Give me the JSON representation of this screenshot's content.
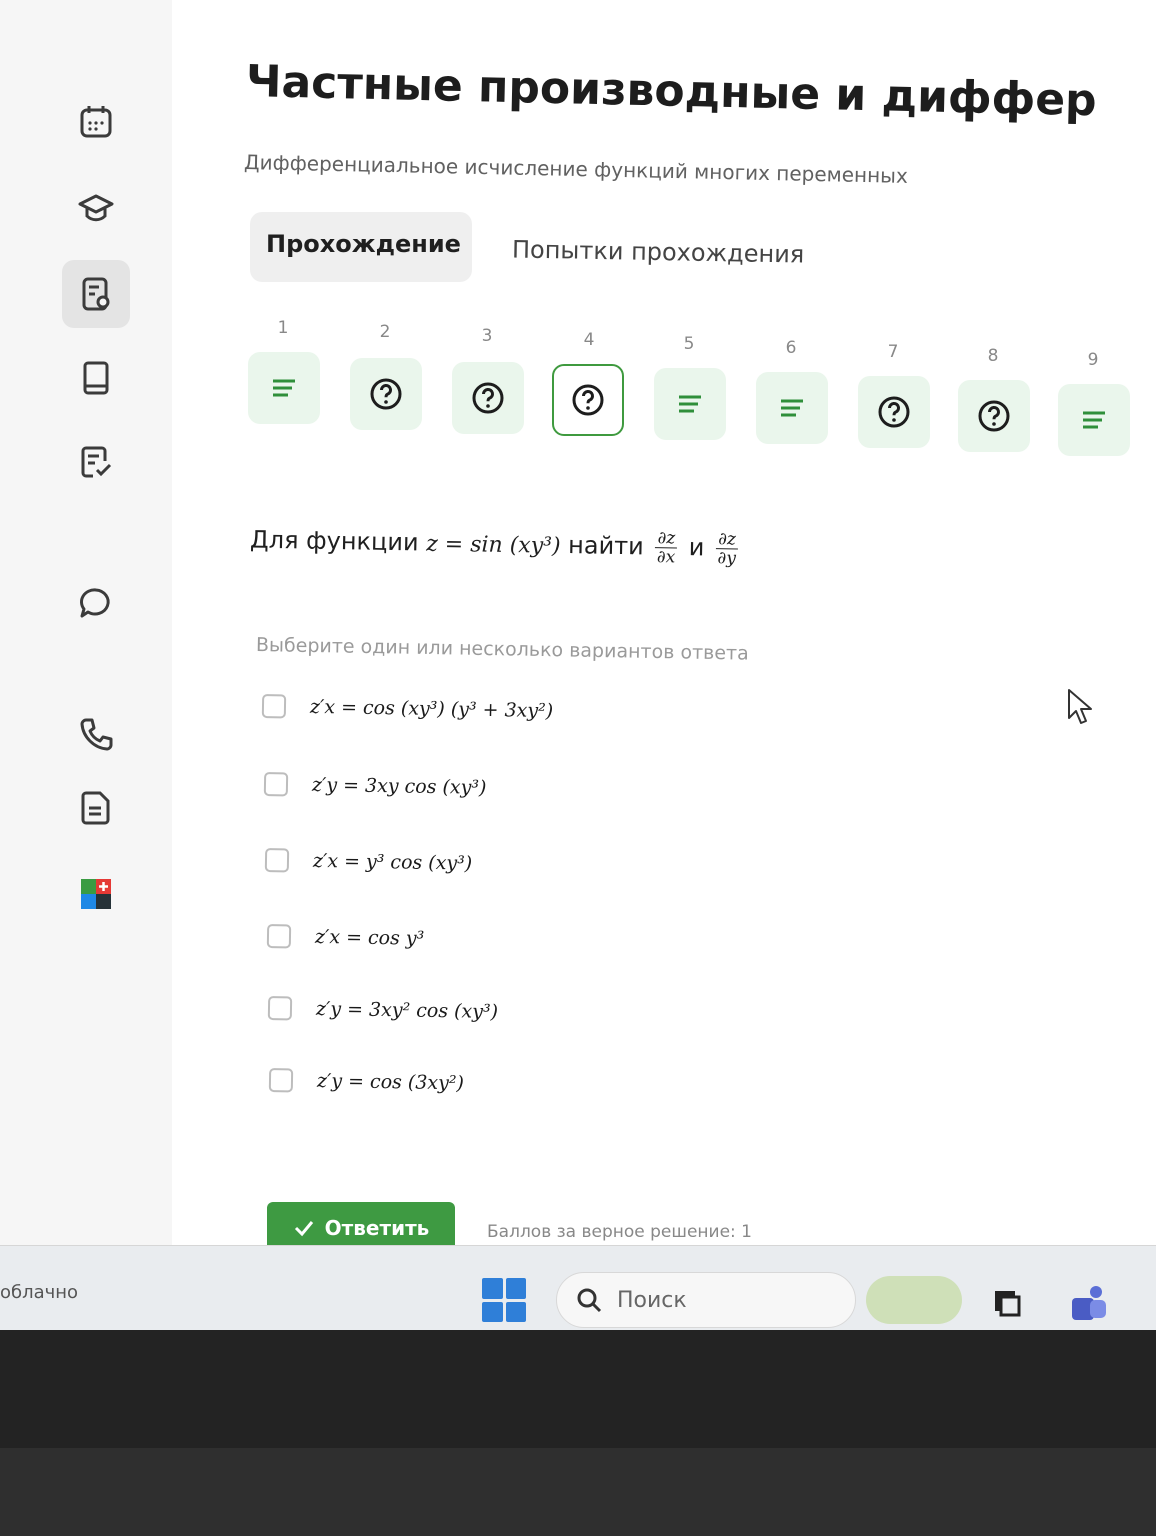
{
  "course": {
    "title": "Частные производные и диффер",
    "subtitle": "Дифференциальное исчисление функций многих переменных"
  },
  "tabs": [
    {
      "label": "Прохождение",
      "active": true
    },
    {
      "label": "Попытки прохождения",
      "active": false
    }
  ],
  "questions": [
    {
      "num": "1",
      "icon": "lines-icon"
    },
    {
      "num": "2",
      "icon": "question-icon"
    },
    {
      "num": "3",
      "icon": "question-icon"
    },
    {
      "num": "4",
      "icon": "question-icon",
      "current": true
    },
    {
      "num": "5",
      "icon": "lines-icon"
    },
    {
      "num": "6",
      "icon": "lines-icon"
    },
    {
      "num": "7",
      "icon": "question-icon"
    },
    {
      "num": "8",
      "icon": "question-icon"
    },
    {
      "num": "9",
      "icon": "lines-icon"
    }
  ],
  "task": {
    "prefix": "Для функции",
    "function": "z = sin (xy³)",
    "middle": "найти",
    "partial_num": "∂z",
    "partial_den_x": "∂x",
    "conj": "и",
    "partial_den_y": "∂y"
  },
  "hint": "Выберите один или несколько вариантов ответа",
  "options": [
    {
      "formula": "z′x = cos (xy³) (y³ + 3xy²)",
      "checked": false
    },
    {
      "formula": "z′y = 3xy cos (xy³)",
      "checked": false
    },
    {
      "formula": "z′x = y³ cos (xy³)",
      "checked": false
    },
    {
      "formula": "z′x = cos y³",
      "checked": false
    },
    {
      "formula": "z′y = 3xy² cos (xy³)",
      "checked": false
    },
    {
      "formula": "z′y = cos (3xy²)",
      "checked": false
    }
  ],
  "submit": {
    "label": "Ответить"
  },
  "points_text": "Баллов за верное решение: 1",
  "taskbar": {
    "weather": "облачно",
    "search_placeholder": "Поиск"
  },
  "colors": {
    "accent": "#3e9a42",
    "question_box_bg": "#eaf6ec",
    "current_border": "#3f9a3f"
  }
}
